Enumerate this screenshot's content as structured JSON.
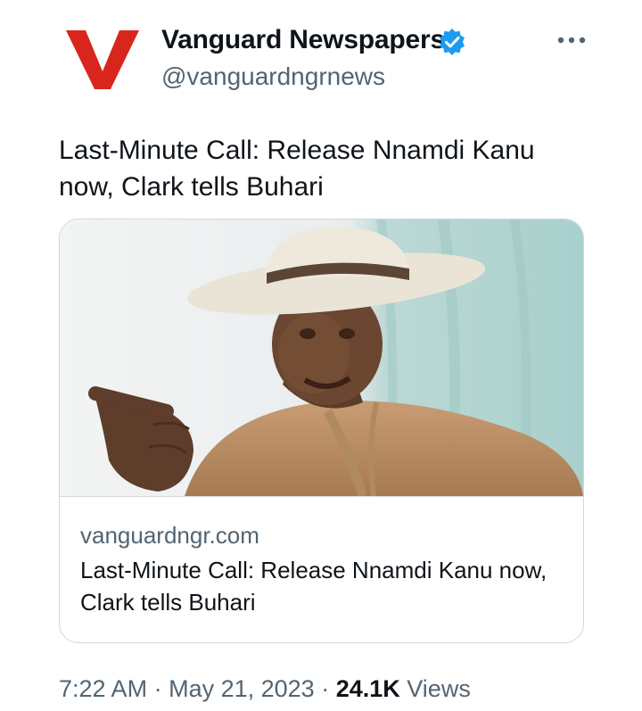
{
  "account": {
    "display_name": "Vanguard Newspapers",
    "handle": "@vanguardngrnews",
    "logo_letter": "V",
    "brand_color": "#d9261c",
    "verified_color": "#1d9bf0"
  },
  "tweet": {
    "text": "Last-Minute Call: Release Nnamdi Kanu now, Clark tells Buhari"
  },
  "link_card": {
    "domain": "vanguardngr.com",
    "title": "Last-Minute Call: Release Nnamdi Kanu now, Clark tells Buhari"
  },
  "meta": {
    "time": "7:22 AM",
    "date": "May 21, 2023",
    "views_count": "24.1K",
    "views_label": "Views"
  },
  "icons": {
    "verified": "verified-badge-icon",
    "more": "more-options-icon"
  }
}
